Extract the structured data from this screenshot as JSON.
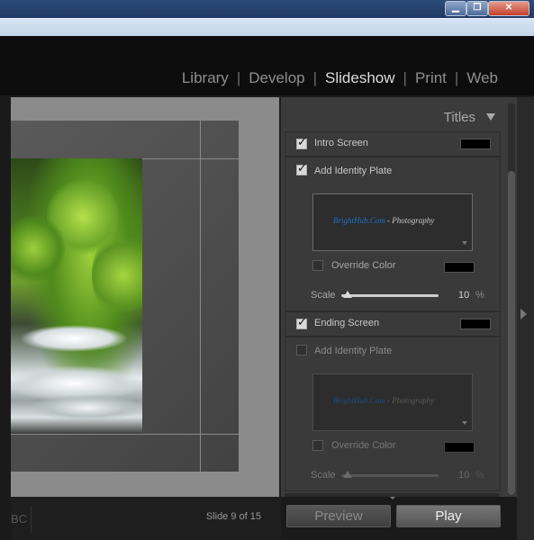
{
  "window": {
    "minimize_glyph": "▁",
    "maximize_glyph": "❐",
    "close_glyph": "✕"
  },
  "modules": {
    "items": [
      "Library",
      "Develop",
      "Slideshow",
      "Print",
      "Web"
    ],
    "active": "Slideshow",
    "separator": "|"
  },
  "view": {
    "status_partial": "BC",
    "slide_counter": "Slide 9 of 15"
  },
  "panel": {
    "header": "Titles",
    "intro": {
      "label": "Intro Screen",
      "checked": true,
      "identity_plate_label": "Add Identity Plate",
      "identity_plate_checked": true,
      "plate_brand": "BrightHub.Com",
      "plate_sub": " - Photography",
      "override_label": "Override Color",
      "scale_label": "Scale",
      "scale_value": "10",
      "scale_unit": "%"
    },
    "ending": {
      "label": "Ending Screen",
      "checked": true,
      "identity_plate_label": "Add Identity Plate",
      "identity_plate_checked": false,
      "plate_brand": "BrightHub.Com",
      "plate_sub": " - Photography",
      "override_label": "Override Color",
      "scale_label": "Scale",
      "scale_value": "10",
      "scale_unit": "%"
    }
  },
  "buttons": {
    "preview": "Preview",
    "play": "Play"
  },
  "colors": {
    "accent_brand": "#1e6fc4",
    "panel_bg": "#3b3b3b",
    "swatch": "#000000"
  }
}
